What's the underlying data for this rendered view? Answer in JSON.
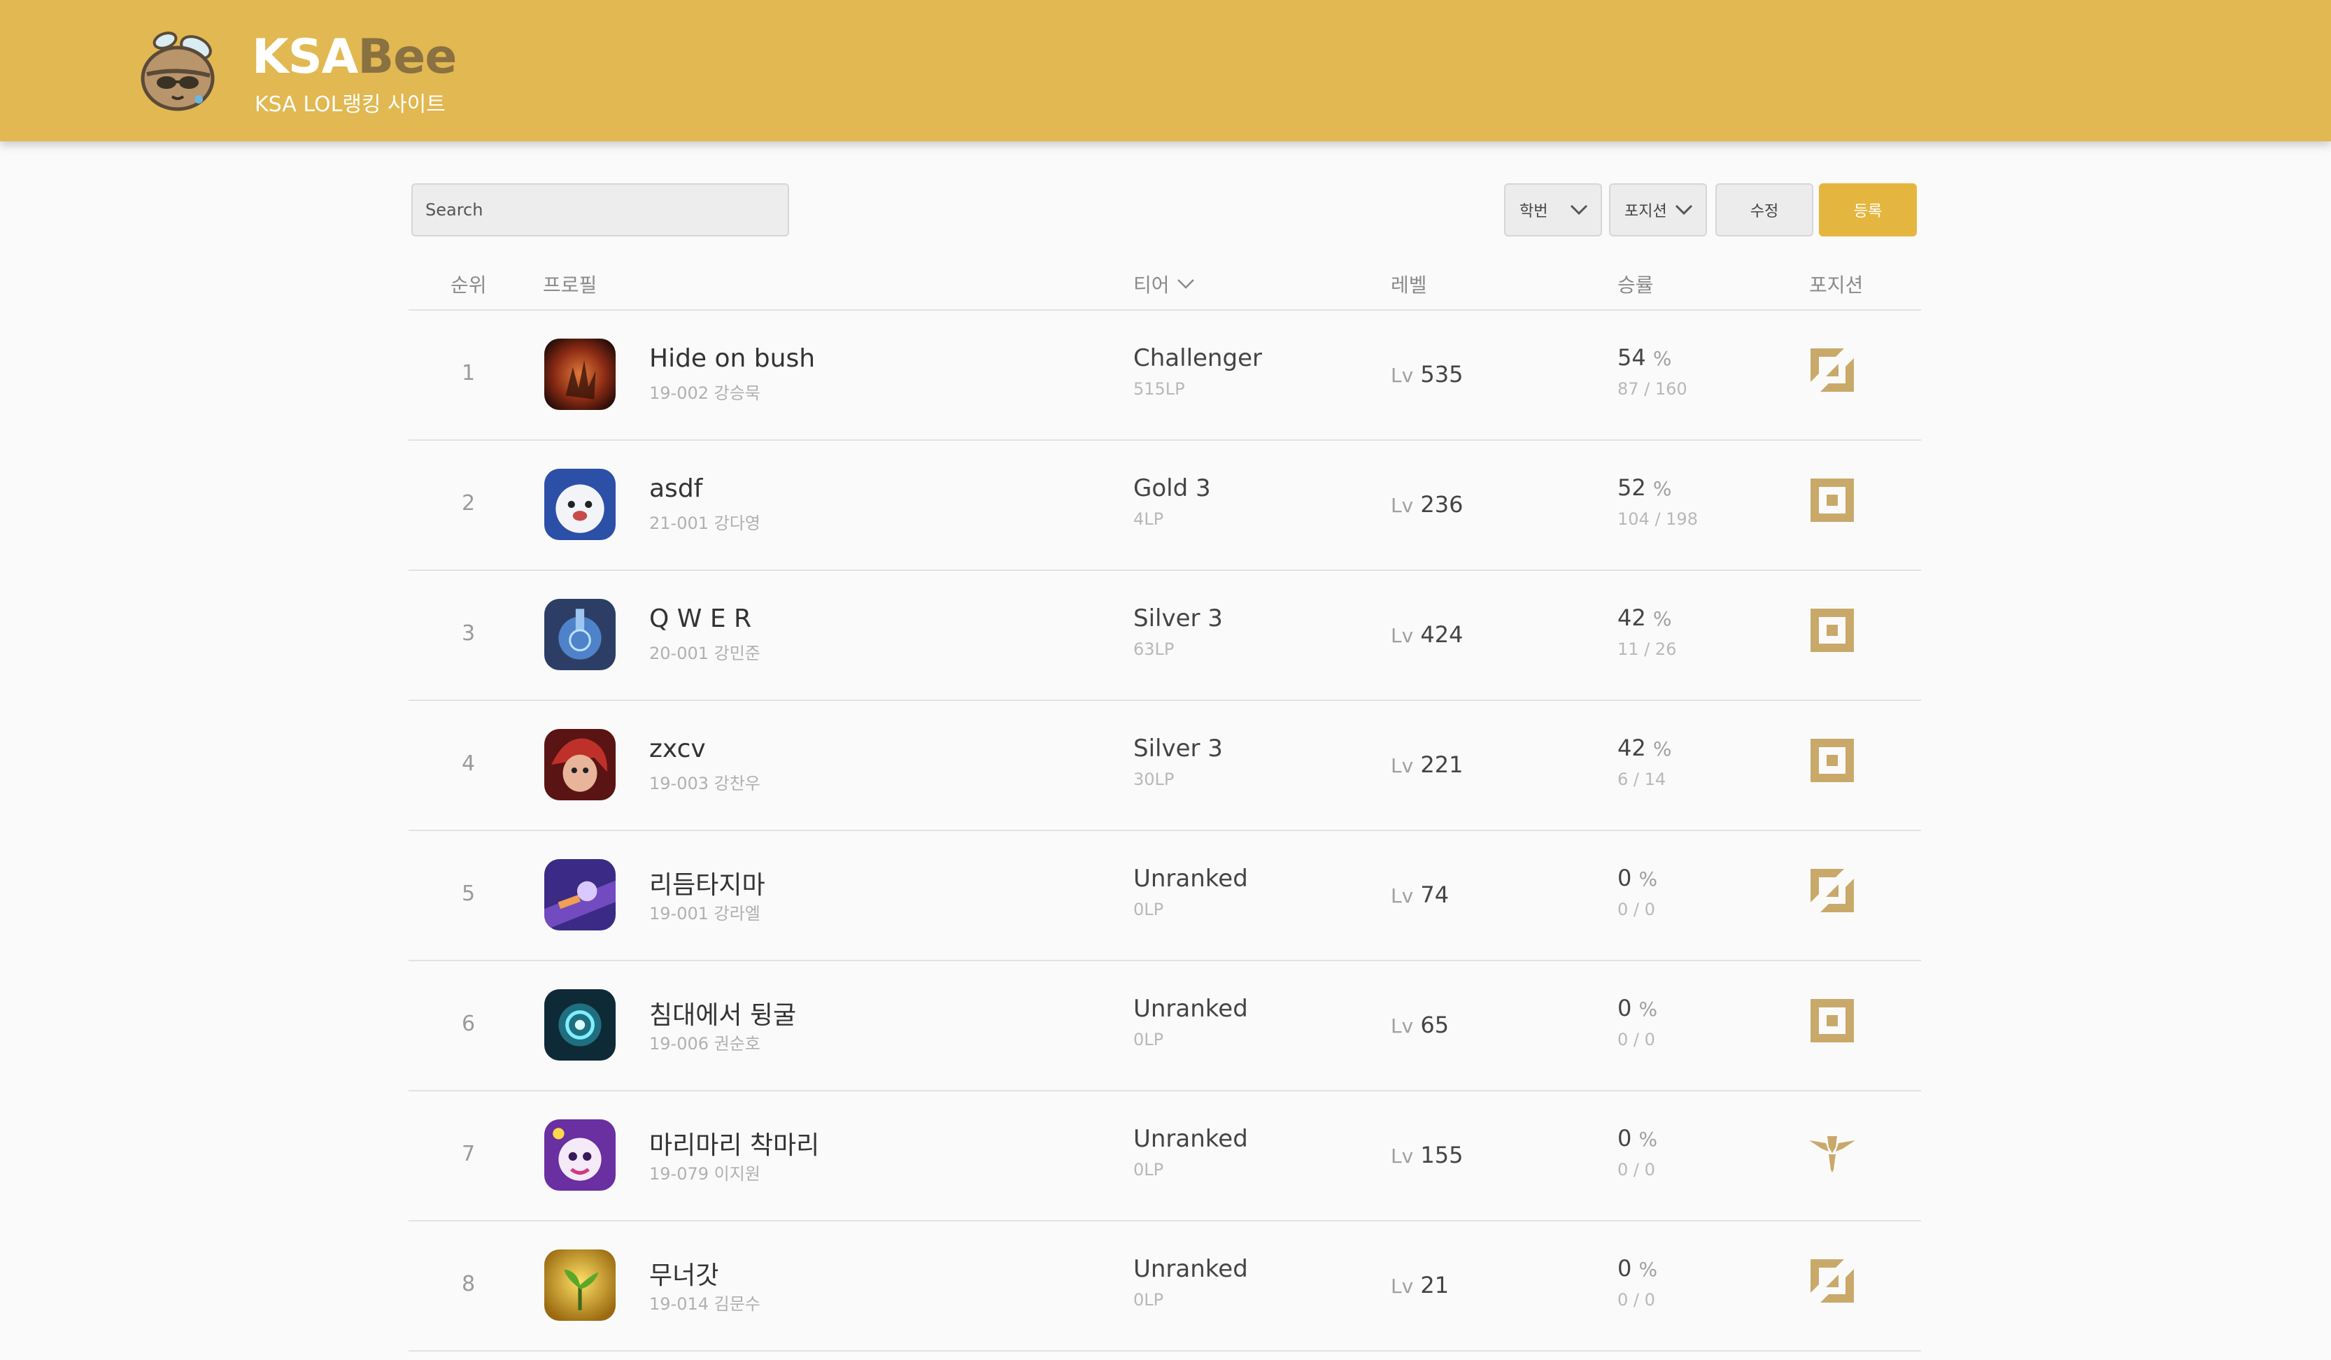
{
  "header": {
    "brand_part1": "KSA",
    "brand_part2": "Bee",
    "tagline": "KSA LOL랭킹 사이트",
    "logo_icon": "bee-mascot-icon",
    "bg_color": "#e1b851"
  },
  "toolbar": {
    "search_placeholder": "Search",
    "filter_student": "학번",
    "filter_position": "포지션",
    "edit_label": "수정",
    "register_label": "등록",
    "accent_color": "#e5b63f"
  },
  "table": {
    "headers": {
      "rank": "순위",
      "profile": "프로필",
      "tier": "티어",
      "level": "레벨",
      "winrate": "승률",
      "position": "포지션"
    },
    "level_prefix": "Lv",
    "percent_sign": "%",
    "rows": [
      {
        "rank": "1",
        "name": "Hide on bush",
        "student": "19-002 강승묵",
        "tier": "Challenger",
        "lp": "515LP",
        "level": "535",
        "winrate": "54",
        "record": "87 / 160",
        "position_icon": "top-lane-icon",
        "avatar_icon": "dark-hand-avatar-icon"
      },
      {
        "rank": "2",
        "name": "asdf",
        "student": "21-001 강다영",
        "tier": "Gold 3",
        "lp": "4LP",
        "level": "236",
        "winrate": "52",
        "record": "104 / 198",
        "position_icon": "middle-lane-icon",
        "avatar_icon": "poro-avatar-icon"
      },
      {
        "rank": "3",
        "name": "Q W E R",
        "student": "20-001 강민준",
        "tier": "Silver 3",
        "lp": "63LP",
        "level": "424",
        "winrate": "42",
        "record": "11 / 26",
        "position_icon": "middle-lane-icon",
        "avatar_icon": "trophy-avatar-icon"
      },
      {
        "rank": "4",
        "name": "zxcv",
        "student": "19-003 강찬우",
        "tier": "Silver 3",
        "lp": "30LP",
        "level": "221",
        "winrate": "42",
        "record": "6 / 14",
        "position_icon": "middle-lane-icon",
        "avatar_icon": "red-hair-avatar-icon"
      },
      {
        "rank": "5",
        "name": "리듬타지마",
        "student": "19-001 강라엘",
        "tier": "Unranked",
        "lp": "0LP",
        "level": "74",
        "winrate": "0",
        "record": "0 / 0",
        "position_icon": "top-lane-icon",
        "avatar_icon": "purple-space-avatar-icon"
      },
      {
        "rank": "6",
        "name": "침대에서 뒹굴",
        "student": "19-006 권순호",
        "tier": "Unranked",
        "lp": "0LP",
        "level": "65",
        "winrate": "0",
        "record": "0 / 0",
        "position_icon": "middle-lane-icon",
        "avatar_icon": "teal-eye-avatar-icon"
      },
      {
        "rank": "7",
        "name": "마리마리 착마리",
        "student": "19-079 이지원",
        "tier": "Unranked",
        "lp": "0LP",
        "level": "155",
        "winrate": "0",
        "record": "0 / 0",
        "position_icon": "support-icon",
        "avatar_icon": "teemo-avatar-icon"
      },
      {
        "rank": "8",
        "name": "무너갓",
        "student": "19-014 김문수",
        "tier": "Unranked",
        "lp": "0LP",
        "level": "21",
        "winrate": "0",
        "record": "0 / 0",
        "position_icon": "top-lane-icon",
        "avatar_icon": "sprout-avatar-icon"
      }
    ]
  }
}
